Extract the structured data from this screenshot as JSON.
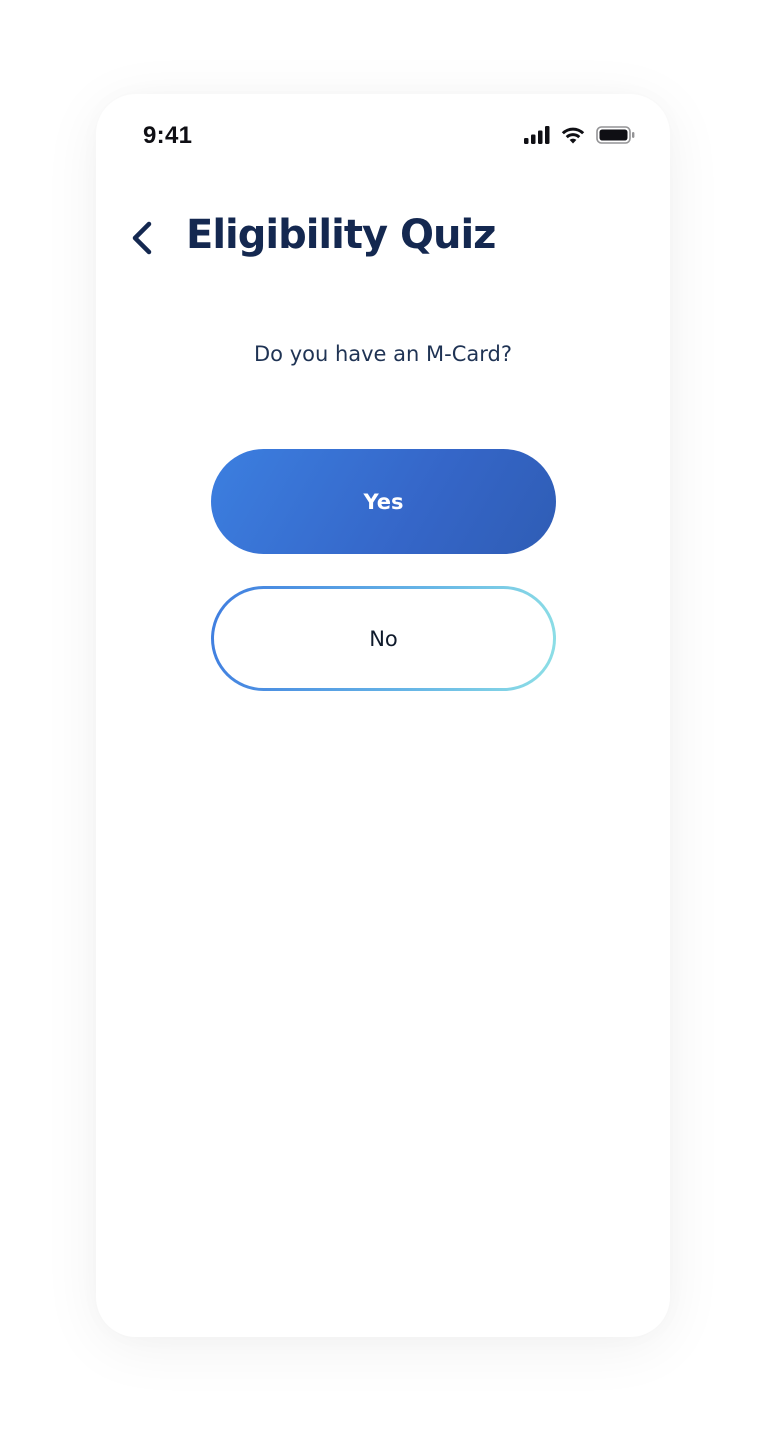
{
  "status_bar": {
    "time": "9:41",
    "signal_icon": "cellular-signal-icon",
    "wifi_icon": "wifi-icon",
    "battery_icon": "battery-icon"
  },
  "header": {
    "back_icon": "chevron-left-icon",
    "title": "Eligibility Quiz"
  },
  "quiz": {
    "question": "Do you have an M-Card?",
    "options": [
      {
        "label": "Yes",
        "style": "filled"
      },
      {
        "label": "No",
        "style": "outline"
      }
    ]
  },
  "colors": {
    "title_text": "#142850",
    "primary_gradient_start": "#3c7fe0",
    "primary_gradient_end": "#2f5db5",
    "outline_gradient_start": "#3f7de0",
    "outline_gradient_end": "#8ee0e6"
  }
}
